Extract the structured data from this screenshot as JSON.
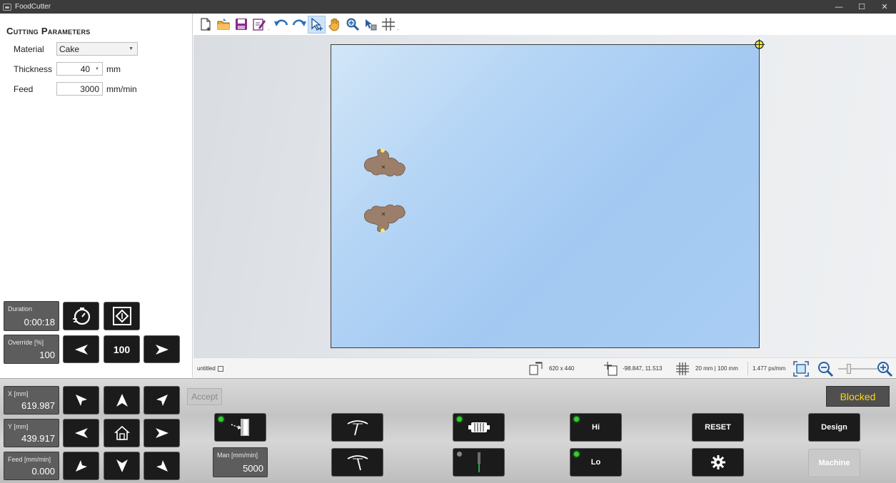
{
  "window": {
    "title": "FoodCutter",
    "minimize": "—",
    "maximize": "☐",
    "close": "✕"
  },
  "params": {
    "heading": "Cutting Parameters",
    "material_label": "Material",
    "material_value": "Cake",
    "thickness_label": "Thickness",
    "thickness_value": "40",
    "thickness_unit": "mm",
    "feed_label": "Feed",
    "feed_value": "3000",
    "feed_unit": "mm/min"
  },
  "job": {
    "duration_label": "Duration",
    "duration_value": "0:00:18",
    "override_label": "Override [%]",
    "override_value": "100",
    "override_button": "100"
  },
  "toolbar": {
    "icons": [
      "new-file-icon",
      "open-folder-icon",
      "save-icon",
      "edit-icon",
      "undo-icon",
      "redo-icon",
      "select-pointer-icon",
      "pan-hand-icon",
      "zoom-magnifier-icon",
      "node-edit-icon",
      "grid-icon"
    ],
    "active": "select-pointer-icon"
  },
  "status": {
    "filename": "untitled",
    "size": "620 x 440",
    "cursor": "-98.847, 11.513",
    "grid": "20 mm | 100 mm",
    "scale": "1.477 px/mm"
  },
  "machine": {
    "x_label": "X [mm]",
    "x_value": "619.987",
    "y_label": "Y [mm]",
    "y_value": "439.917",
    "feed_label": "Feed [mm/min]",
    "feed_value": "0.000",
    "accept": "Accept",
    "man_label": "Man [mm/min]",
    "man_value": "5000",
    "hi": "Hi",
    "lo": "Lo",
    "reset": "RESET",
    "blocked": "Blocked",
    "design": "Design",
    "machine": "Machine"
  },
  "colors": {
    "blocked_text": "#ffd31a",
    "led_on": "#2ed12e",
    "board": "#a3c9f2",
    "shape": "#9b7f6b"
  }
}
